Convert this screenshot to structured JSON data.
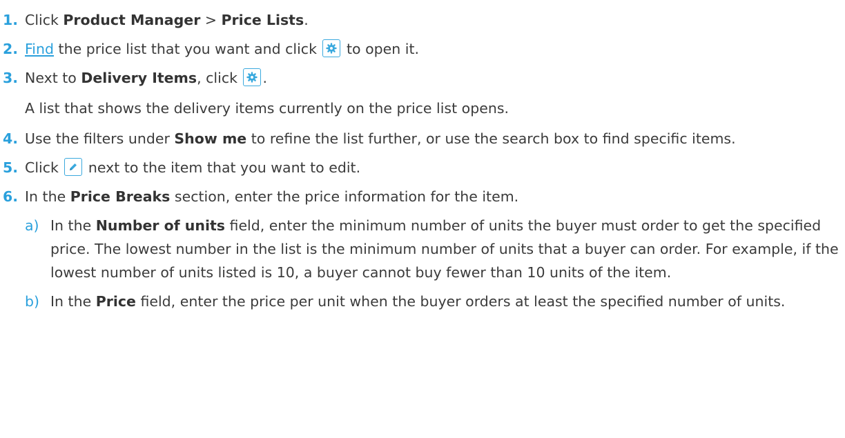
{
  "steps": [
    {
      "num": "1.",
      "pre": "Click ",
      "b1": "Product Manager",
      "mid": " > ",
      "b2": "Price Lists",
      "post": "."
    },
    {
      "num": "2.",
      "link": "Find",
      "pre": " the price list that you want and click ",
      "post": " to open it."
    },
    {
      "num": "3.",
      "pre": "Next to ",
      "b1": "Delivery Items",
      "mid": ", click ",
      "post": "."
    },
    {
      "num": "4.",
      "pre": "Use the filters under ",
      "b1": "Show me",
      "post": " to refine the list further, or use the search box to find specific items."
    },
    {
      "num": "5.",
      "pre": "Click ",
      "post": " next to the item that you want to edit."
    },
    {
      "num": "6.",
      "pre": "In the ",
      "b1": "Price Breaks",
      "post": " section, enter the price information for the item."
    }
  ],
  "note3": "A list that shows the delivery items currently on the price list opens.",
  "substeps": [
    {
      "letter": "a)",
      "pre": "In the ",
      "b1": "Number of units",
      "post": " field, enter the minimum number of units the buyer must order to get the specified price. The lowest number in the list is the minimum number of units that a buyer can order. For example, if the lowest number of units listed is 10, a buyer cannot buy fewer than 10 units of the item."
    },
    {
      "letter": "b)",
      "pre": "In the ",
      "b1": "Price",
      "post": " field, enter the price per unit when the buyer orders at least the specified number of units."
    }
  ],
  "icons": {
    "settings": "gear-icon",
    "edit": "pencil-icon"
  },
  "colors": {
    "accent": "#2aa0dc",
    "text": "#3b3b3b"
  }
}
